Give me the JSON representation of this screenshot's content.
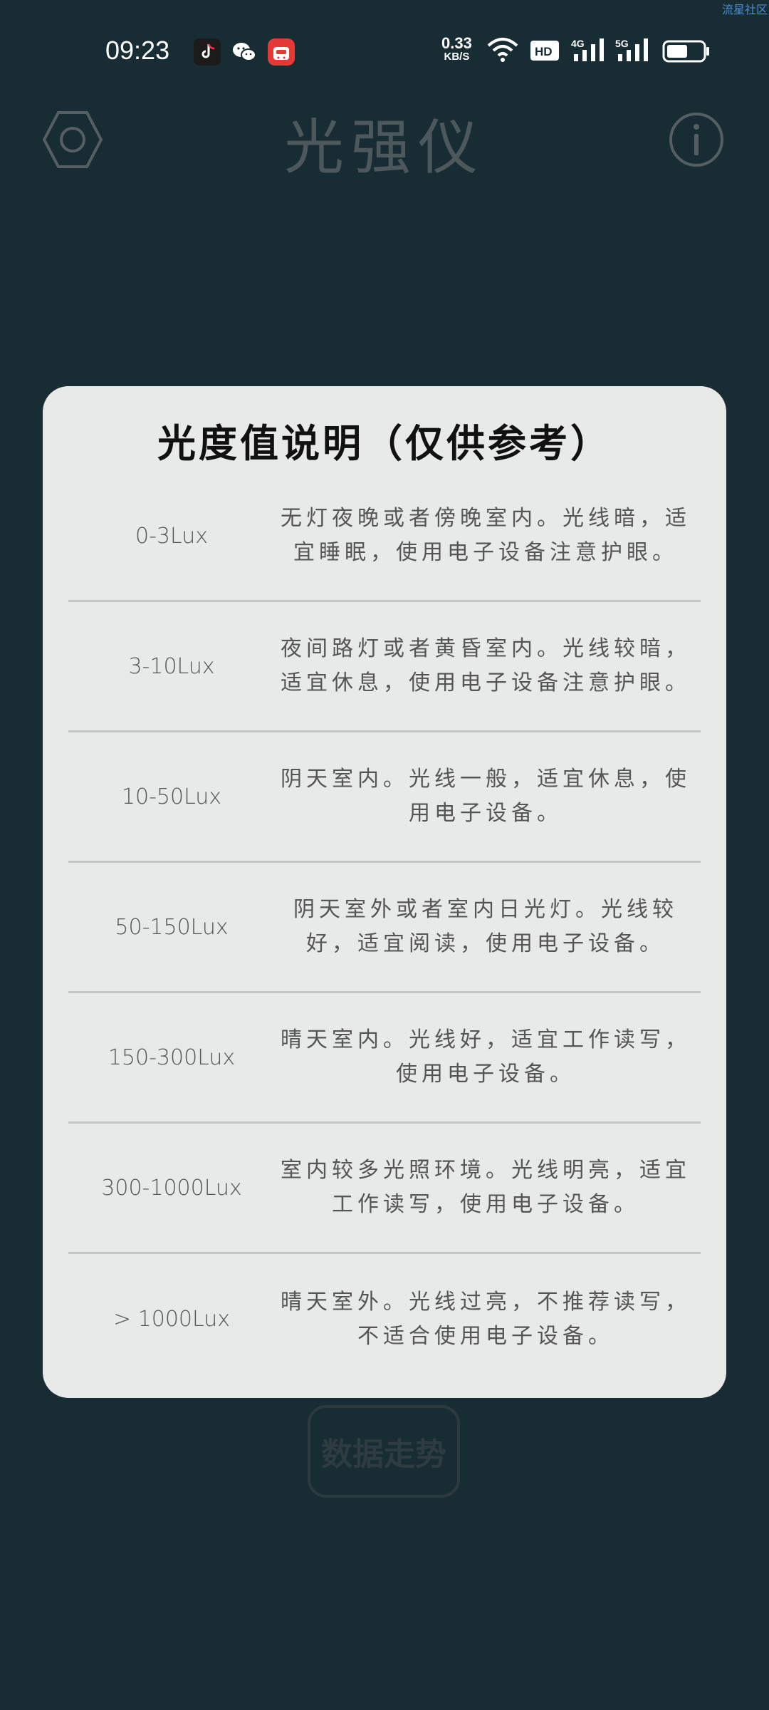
{
  "watermark": "流星社区",
  "status_bar": {
    "time": "09:23",
    "net_speed_value": "0.33",
    "net_speed_unit": "KB/S",
    "hd_label": "HD",
    "sig1_label": "4G",
    "sig2_label": "5G"
  },
  "header": {
    "title": "光强仪"
  },
  "background": {
    "trend_button_label": "数据走势"
  },
  "dialog": {
    "title": "光度值说明（仅供参考）",
    "rows": [
      {
        "range": "0-3Lux",
        "desc": "无灯夜晚或者傍晚室内。光线暗，适宜睡眠，使用电子设备注意护眼。"
      },
      {
        "range": "3-10Lux",
        "desc": "夜间路灯或者黄昏室内。光线较暗，适宜休息，使用电子设备注意护眼。"
      },
      {
        "range": "10-50Lux",
        "desc": "阴天室内。光线一般，适宜休息，使用电子设备。"
      },
      {
        "range": "50-150Lux",
        "desc": "阴天室外或者室内日光灯。光线较好，适宜阅读，使用电子设备。"
      },
      {
        "range": "150-300Lux",
        "desc": "晴天室内。光线好，适宜工作读写，使用电子设备。"
      },
      {
        "range": "300-1000Lux",
        "desc": "室内较多光照环境。光线明亮，适宜工作读写，使用电子设备。"
      },
      {
        "range": "> 1000Lux",
        "desc": "晴天室外。光线过亮，不推荐读写，不适合使用电子设备。"
      }
    ]
  },
  "colors": {
    "background": "#172c33",
    "dialog": "#e8e9e9",
    "header_icon": "#555f63"
  },
  "icons": {
    "settings": "hexagon-settings-icon",
    "info": "info-icon",
    "tiktok": "tiktok-icon",
    "wechat": "wechat-icon",
    "shop": "shop-618-icon"
  }
}
